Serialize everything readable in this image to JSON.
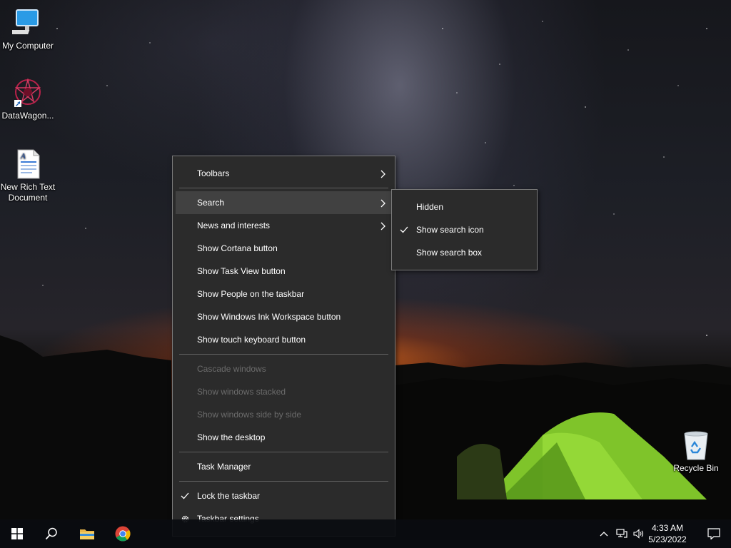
{
  "desktop": {
    "icons": [
      {
        "label": "My Computer",
        "icon": "computer-icon"
      },
      {
        "label": "DataWagon...",
        "icon": "datawagon-icon"
      },
      {
        "label": "New Rich Text Document",
        "icon": "rtf-document-icon"
      },
      {
        "label": "Recycle Bin",
        "icon": "recycle-bin-icon"
      }
    ]
  },
  "context_menu": {
    "items": [
      {
        "label": "Toolbars",
        "submenu": true
      },
      {
        "label": "Search",
        "submenu": true,
        "highlighted": true
      },
      {
        "label": "News and interests",
        "submenu": true
      },
      {
        "label": "Show Cortana button"
      },
      {
        "label": "Show Task View button"
      },
      {
        "label": "Show People on the taskbar"
      },
      {
        "label": "Show Windows Ink Workspace button"
      },
      {
        "label": "Show touch keyboard button"
      },
      {
        "label": "Cascade windows",
        "disabled": true
      },
      {
        "label": "Show windows stacked",
        "disabled": true
      },
      {
        "label": "Show windows side by side",
        "disabled": true
      },
      {
        "label": "Show the desktop"
      },
      {
        "label": "Task Manager"
      },
      {
        "label": "Lock the taskbar",
        "checked": true
      },
      {
        "label": "Taskbar settings",
        "icon": "gear-icon"
      }
    ]
  },
  "search_submenu": {
    "items": [
      {
        "label": "Hidden"
      },
      {
        "label": "Show search icon",
        "checked": true
      },
      {
        "label": "Show search box"
      }
    ]
  },
  "taskbar": {
    "pinned": [
      {
        "icon": "windows-start-icon"
      },
      {
        "icon": "search-icon"
      },
      {
        "icon": "file-explorer-icon"
      },
      {
        "icon": "chrome-icon"
      }
    ],
    "tray": {
      "icons": [
        "chevron-up-icon",
        "network-icon",
        "volume-icon",
        "notification-icon"
      ],
      "time": "4:33 AM",
      "date": "5/23/2022"
    }
  }
}
